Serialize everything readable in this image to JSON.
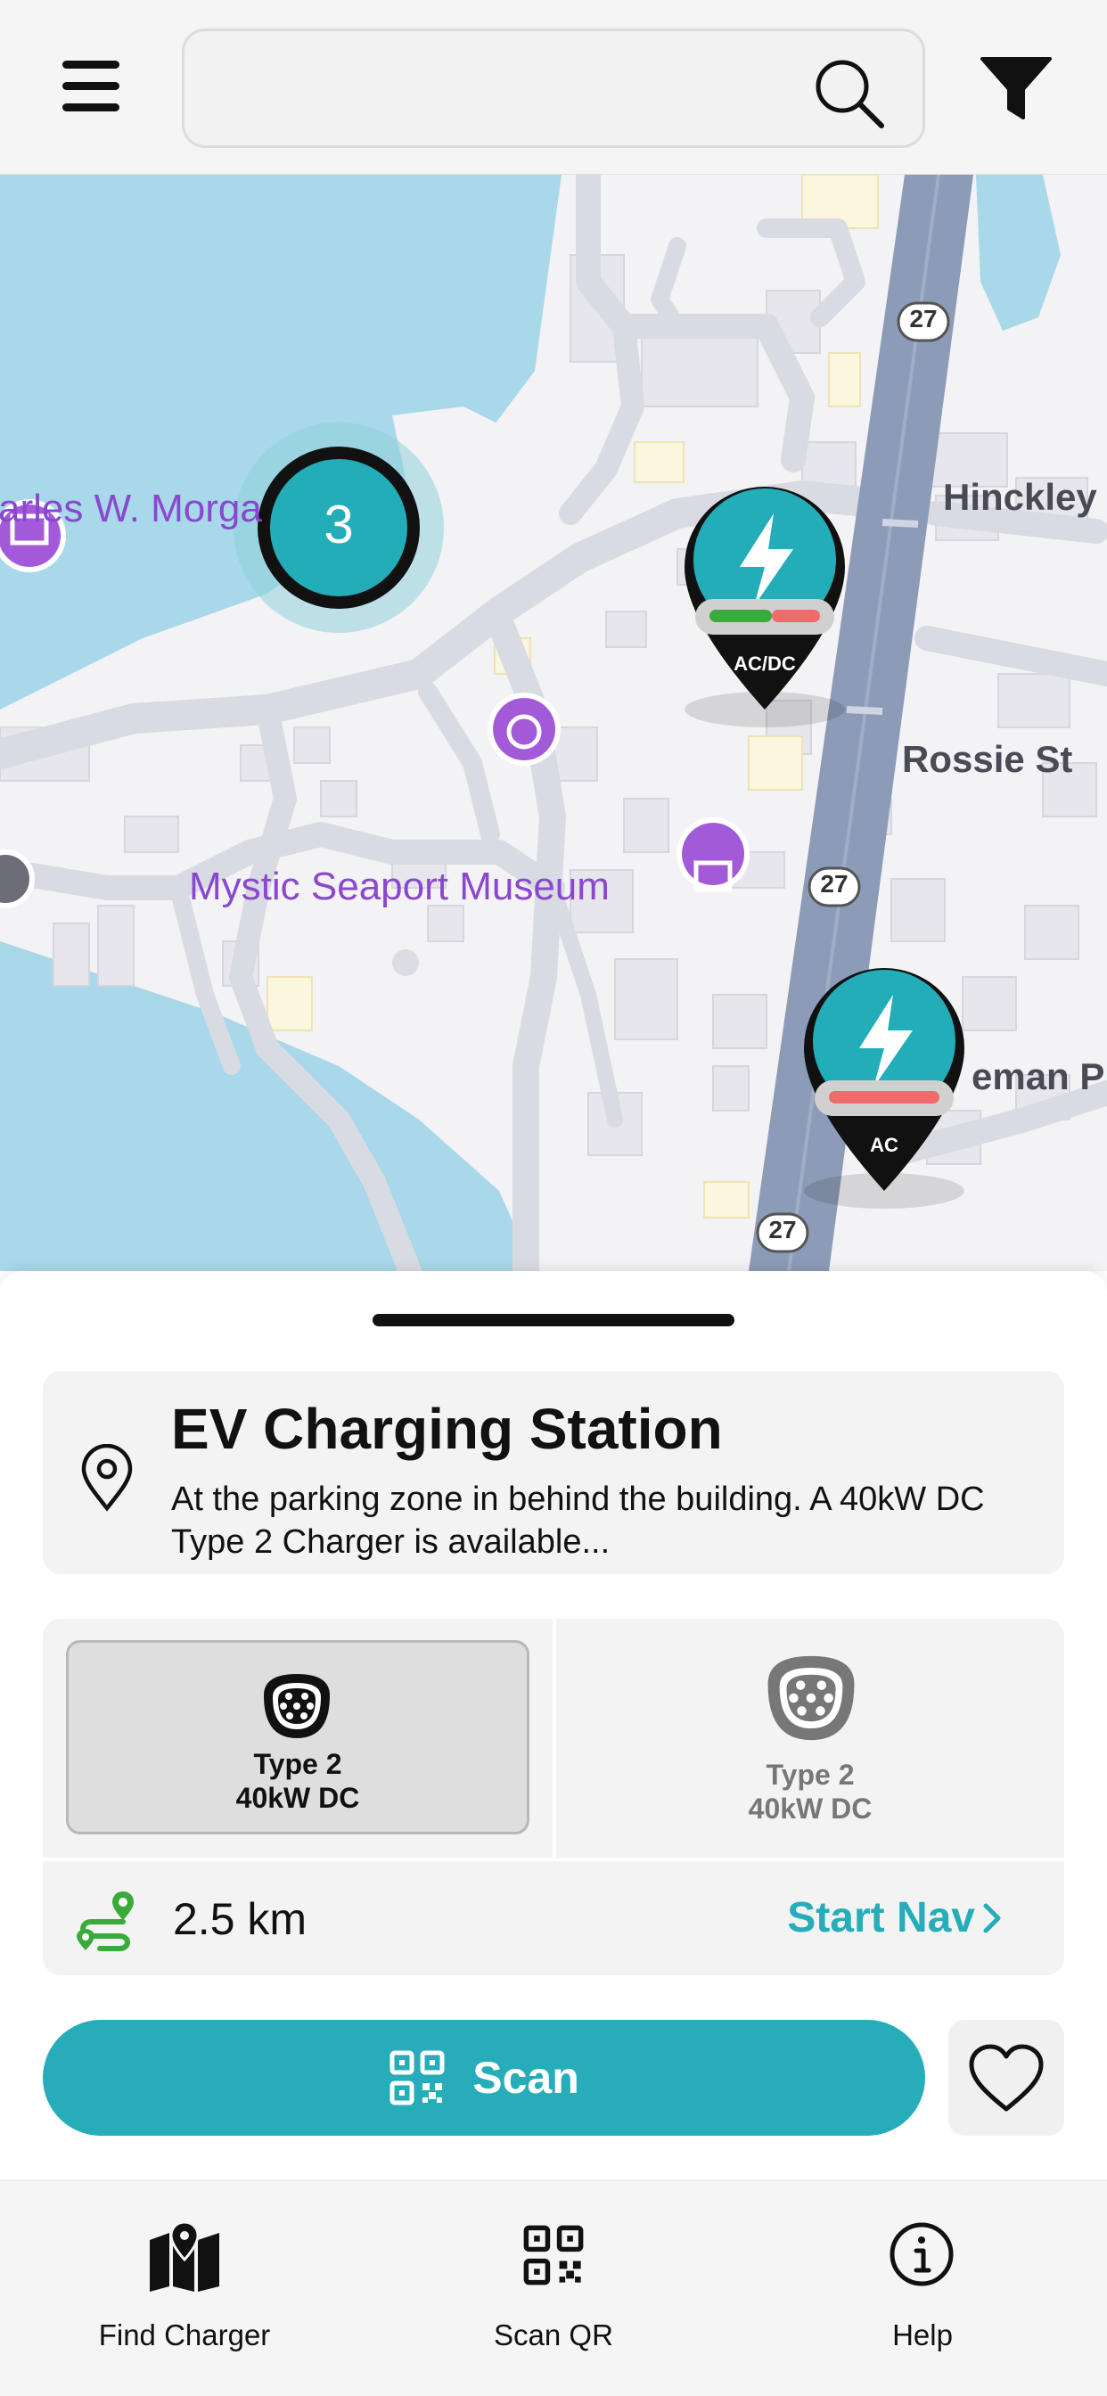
{
  "header": {
    "search_placeholder": "",
    "icons": [
      "menu-icon",
      "search-icon",
      "filter-icon"
    ]
  },
  "map": {
    "labels": {
      "museum_partial": "arles W. Morga",
      "seaport": "Mystic Seaport Museum",
      "hinckley": "Hinckley",
      "rossie": "Rossie St",
      "street_partial": "eman P"
    },
    "route_shields": [
      "27",
      "27",
      "27"
    ],
    "cluster_count": "3",
    "markers": [
      {
        "type_label": "AC/DC",
        "bar_green_fraction": 0.55
      },
      {
        "type_label": "AC",
        "bar_green_fraction": 0
      }
    ],
    "colors": {
      "water": "#a8d8ea",
      "station_teal": "#22adb8",
      "poi_purple": "#a35ad8",
      "road_blue": "#8c9bb7"
    }
  },
  "station": {
    "title": "EV Charging Station",
    "description": "At the parking zone in behind the building. A 40kW DC Type 2 Charger is available..."
  },
  "connectors": [
    {
      "line1": "Type 2",
      "line2": "40kW DC",
      "selected": true
    },
    {
      "line1": "Type 2",
      "line2": "40kW DC",
      "selected": false
    }
  ],
  "navigation": {
    "distance": "2.5 km",
    "start_label": "Start Nav"
  },
  "actions": {
    "scan_label": "Scan"
  },
  "bottom_nav": {
    "tabs": [
      {
        "label": "Find Charger",
        "icon": "map-icon"
      },
      {
        "label": "Scan QR",
        "icon": "qr-icon"
      },
      {
        "label": "Help",
        "icon": "info-icon"
      }
    ]
  },
  "theme": {
    "accent": "#26adb9",
    "route_green": "#3aaa3a"
  }
}
